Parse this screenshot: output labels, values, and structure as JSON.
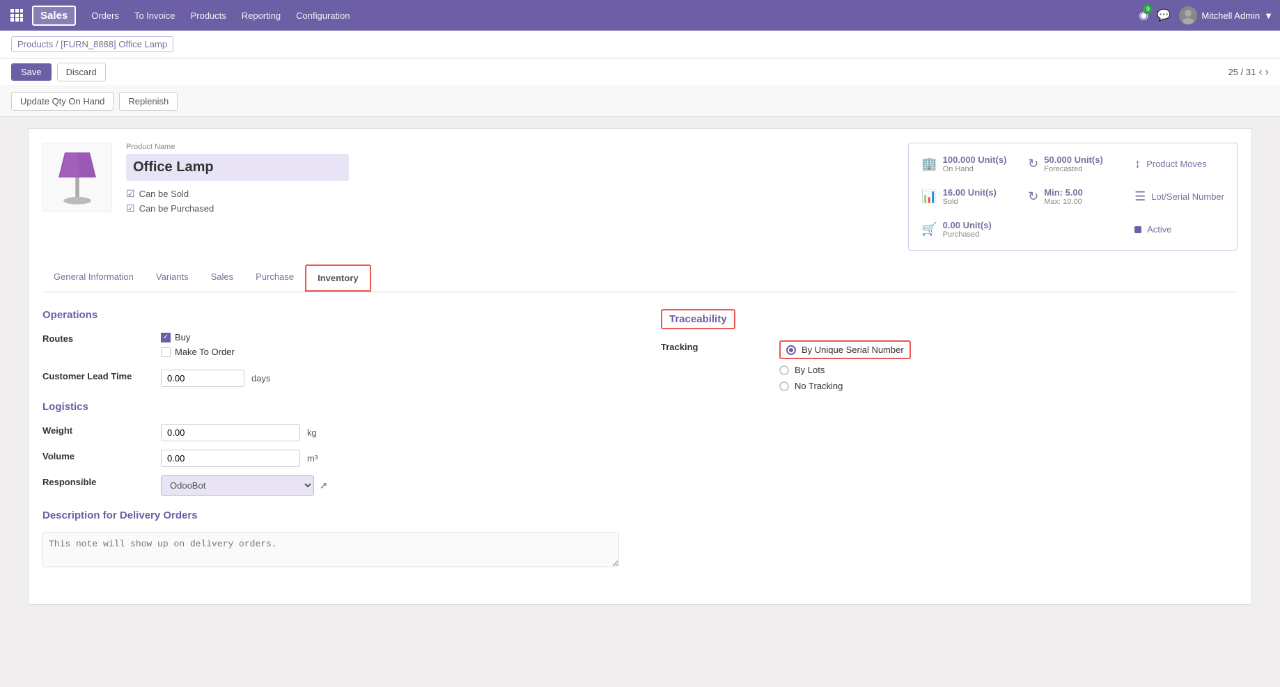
{
  "topnav": {
    "app_name": "Sales",
    "links": [
      "Orders",
      "To Invoice",
      "Products",
      "Reporting",
      "Configuration"
    ],
    "badge_count": "9",
    "user_name": "Mitchell Admin"
  },
  "breadcrumb": {
    "parent": "Products / [FURN_8888] Office Lamp",
    "parts": [
      "Products",
      "[FURN_8888] Office Lamp"
    ]
  },
  "action_bar": {
    "save_label": "Save",
    "discard_label": "Discard",
    "pager": "25 / 31"
  },
  "top_actions": {
    "update_qty_label": "Update Qty On Hand",
    "replenish_label": "Replenish"
  },
  "product": {
    "name_label": "Product Name",
    "name": "Office Lamp",
    "can_be_sold": "Can be Sold",
    "can_be_purchased": "Can be Purchased"
  },
  "stats": {
    "on_hand_value": "100.000 Unit(s)",
    "on_hand_label": "On Hand",
    "forecasted_value": "50.000 Unit(s)",
    "forecasted_label": "Forecasted",
    "product_moves_label": "Product Moves",
    "sold_value": "16.00 Unit(s)",
    "sold_label": "Sold",
    "min_label": "Min: 5.00",
    "max_label": "Max: 10.00",
    "lot_serial_label": "Lot/Serial Number",
    "purchased_value": "0.00 Unit(s)",
    "purchased_label": "Purchased",
    "active_label": "Active"
  },
  "tabs": {
    "items": [
      "General Information",
      "Variants",
      "Sales",
      "Purchase",
      "Inventory"
    ],
    "active_index": 4
  },
  "operations": {
    "section_title": "Operations",
    "routes_label": "Routes",
    "buy_label": "Buy",
    "make_to_order_label": "Make To Order",
    "lead_time_label": "Customer Lead Time",
    "lead_time_value": "0.00",
    "lead_time_unit": "days"
  },
  "traceability": {
    "section_title": "Traceability",
    "tracking_label": "Tracking",
    "options": [
      "By Unique Serial Number",
      "By Lots",
      "No Tracking"
    ],
    "selected_index": 0
  },
  "logistics": {
    "section_title": "Logistics",
    "weight_label": "Weight",
    "weight_value": "0.00",
    "weight_unit": "kg",
    "volume_label": "Volume",
    "volume_value": "0.00",
    "volume_unit": "m³",
    "responsible_label": "Responsible",
    "responsible_value": "OdooBot"
  },
  "delivery_description": {
    "section_title": "Description for Delivery Orders",
    "placeholder": "This note will show up on delivery orders."
  }
}
